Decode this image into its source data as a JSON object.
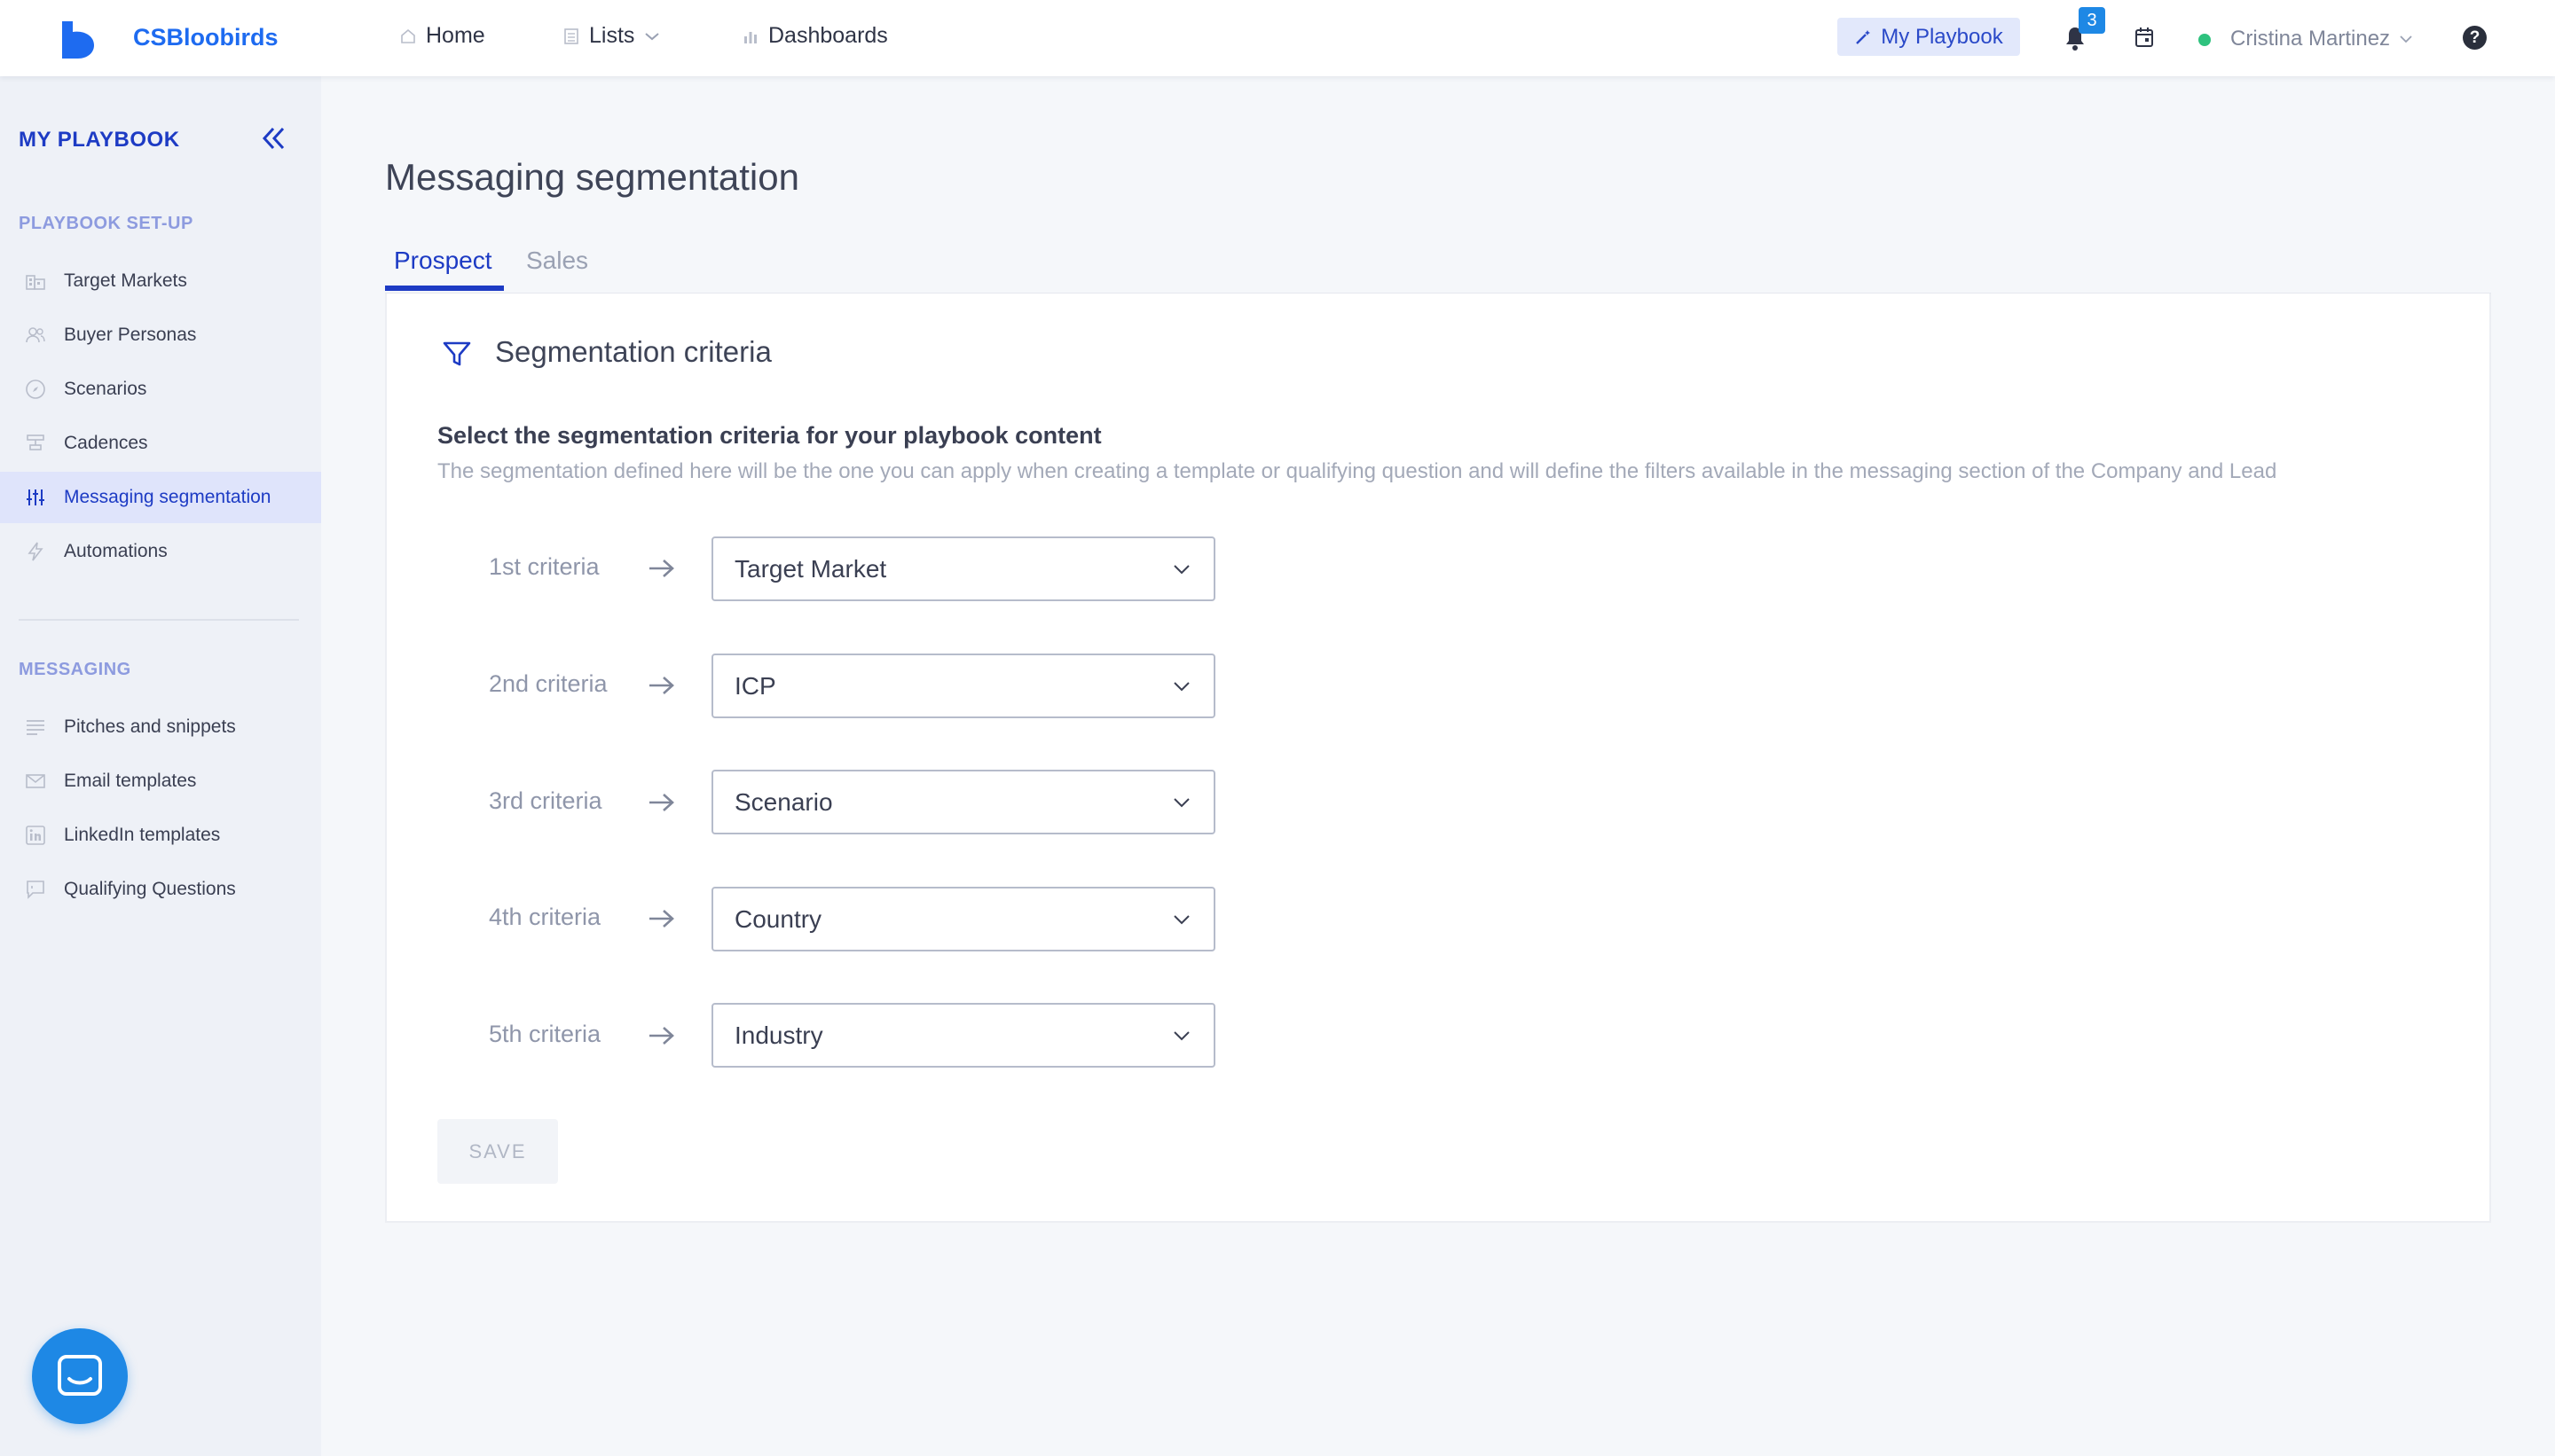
{
  "app": {
    "brand": "CSBloobirds"
  },
  "topnav": {
    "home": "Home",
    "lists": "Lists",
    "dashboards": "Dashboards",
    "playbook": "My Playbook",
    "notifications_count": "3",
    "user_name": "Cristina Martinez",
    "help": "?"
  },
  "sidebar": {
    "title": "MY PLAYBOOK",
    "sections": [
      {
        "label": "PLAYBOOK SET-UP",
        "items": [
          {
            "label": "Target Markets",
            "icon": "building-icon"
          },
          {
            "label": "Buyer Personas",
            "icon": "people-icon"
          },
          {
            "label": "Scenarios",
            "icon": "compass-icon"
          },
          {
            "label": "Cadences",
            "icon": "cadence-icon"
          },
          {
            "label": "Messaging segmentation",
            "icon": "sliders-icon",
            "active": true
          },
          {
            "label": "Automations",
            "icon": "bolt-icon"
          }
        ]
      },
      {
        "label": "MESSAGING",
        "items": [
          {
            "label": "Pitches and snippets",
            "icon": "lines-icon"
          },
          {
            "label": "Email templates",
            "icon": "mail-icon"
          },
          {
            "label": "LinkedIn templates",
            "icon": "linkedin-icon"
          },
          {
            "label": "Qualifying Questions",
            "icon": "chat-icon"
          }
        ]
      }
    ]
  },
  "main": {
    "title": "Messaging segmentation",
    "tabs": [
      {
        "label": "Prospect",
        "active": true
      },
      {
        "label": "Sales",
        "active": false
      }
    ],
    "card": {
      "title": "Segmentation criteria",
      "heading": "Select the segmentation criteria for your playbook content",
      "description": "The segmentation defined here will be the one you can apply when creating a template or qualifying question and will define the filters available in the messaging section of the Company and Lead",
      "criteria": [
        {
          "label": "1st criteria",
          "value": "Target Market"
        },
        {
          "label": "2nd criteria",
          "value": "ICP"
        },
        {
          "label": "3rd criteria",
          "value": "Scenario"
        },
        {
          "label": "4th criteria",
          "value": "Country"
        },
        {
          "label": "5th criteria",
          "value": "Industry"
        }
      ],
      "save_label": "SAVE"
    }
  },
  "colors": {
    "accent": "#1d3bc4",
    "brand": "#1e6bf0",
    "badge": "#1e88e5",
    "online": "#2ec27e"
  }
}
